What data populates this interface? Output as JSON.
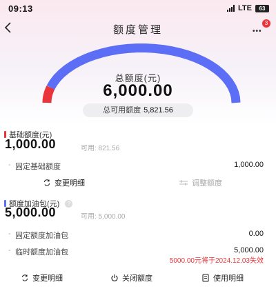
{
  "status_bar": {
    "time": "09:13",
    "network": "LTE",
    "battery": "63"
  },
  "nav": {
    "title": "额度管理",
    "back_icon": "chevron-left-icon",
    "more_icon": "more-dots-icon",
    "notification_count": "3"
  },
  "gauge": {
    "label": "总额度(元)",
    "total": "6,000.00",
    "used_fraction": 0.0297,
    "available_label": "总可用额度",
    "available_value": "5,821.56",
    "colors": {
      "used": "#e9353a",
      "available": "#5b6ef5",
      "track": "#e7e8ef"
    }
  },
  "base_quota": {
    "title": "基础额度(元)",
    "amount": "1,000.00",
    "available_text": "可用: 821.56",
    "accent": "#e9353a",
    "rows": [
      {
        "label": "固定基础额度",
        "value": "1,000.00"
      }
    ],
    "actions": [
      {
        "label": "变更明细",
        "icon": "refresh-icon",
        "enabled": true
      },
      {
        "label": "调整额度",
        "icon": "adjust-icon",
        "enabled": false
      }
    ]
  },
  "fuel_pack": {
    "title": "额度加油包(元)",
    "amount": "5,000.00",
    "available_text": "可用: 5,000.00",
    "accent": "#5b6ef5",
    "info_icon": "info-icon",
    "rows": [
      {
        "label": "固定额度加油包",
        "value": "0.00"
      },
      {
        "label": "临时额度加油包",
        "value": "5,000.00"
      }
    ],
    "expire_note": "5000.00元将于2024.12.03失效",
    "actions": [
      {
        "label": "变更明细",
        "icon": "refresh-icon"
      },
      {
        "label": "关闭额度",
        "icon": "power-icon"
      },
      {
        "label": "使用明细",
        "icon": "document-icon"
      }
    ]
  }
}
